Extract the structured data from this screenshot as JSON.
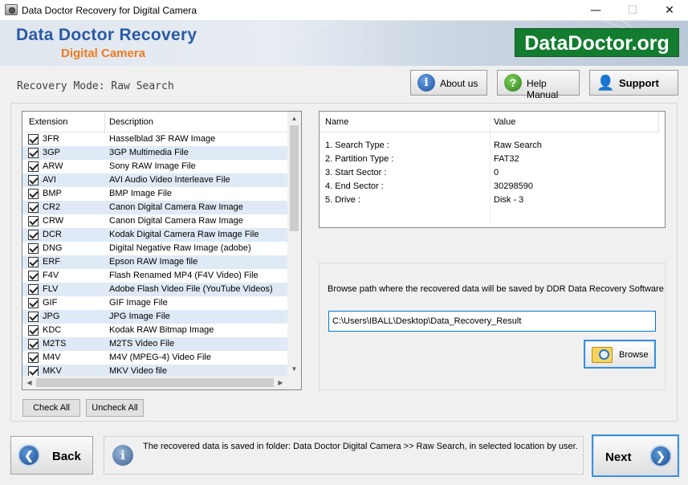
{
  "window": {
    "title": "Data Doctor Recovery for Digital Camera",
    "min": "—",
    "max": "☐",
    "close": "✕"
  },
  "banner": {
    "brand_line1": "Data Doctor Recovery",
    "brand_line2": "Digital Camera",
    "logo": "DataDoctor.org"
  },
  "header": {
    "mode_label": "Recovery Mode: Raw Search",
    "about_label": "About us",
    "help_label": "Help Manual",
    "support_label": "Support"
  },
  "extensions": {
    "col_extension": "Extension",
    "col_description": "Description",
    "items": [
      {
        "ext": "3FR",
        "desc": "Hasselblad 3F RAW Image"
      },
      {
        "ext": "3GP",
        "desc": "3GP Multimedia File"
      },
      {
        "ext": "ARW",
        "desc": "Sony RAW Image File"
      },
      {
        "ext": "AVI",
        "desc": "AVI Audio Video Interleave File"
      },
      {
        "ext": "BMP",
        "desc": "BMP Image File"
      },
      {
        "ext": "CR2",
        "desc": "Canon Digital Camera Raw Image"
      },
      {
        "ext": "CRW",
        "desc": "Canon Digital Camera Raw Image"
      },
      {
        "ext": "DCR",
        "desc": "Kodak Digital Camera Raw Image File"
      },
      {
        "ext": "DNG",
        "desc": "Digital Negative Raw Image (adobe)"
      },
      {
        "ext": "ERF",
        "desc": "Epson RAW Image file"
      },
      {
        "ext": "F4V",
        "desc": "Flash Renamed MP4 (F4V Video) File"
      },
      {
        "ext": "FLV",
        "desc": "Adobe Flash Video File (YouTube Videos)"
      },
      {
        "ext": "GIF",
        "desc": "GIF Image File"
      },
      {
        "ext": "JPG",
        "desc": "JPG Image File"
      },
      {
        "ext": "KDC",
        "desc": "Kodak RAW Bitmap Image"
      },
      {
        "ext": "M2TS",
        "desc": "M2TS Video File"
      },
      {
        "ext": "M4V",
        "desc": "M4V (MPEG-4) Video File"
      },
      {
        "ext": "MKV",
        "desc": "MKV Video file"
      }
    ],
    "check_all": "Check All",
    "uncheck_all": "Uncheck All"
  },
  "properties": {
    "col_name": "Name",
    "col_value": "Value",
    "rows": [
      {
        "name": "1. Search Type :",
        "value": "Raw Search"
      },
      {
        "name": "2. Partition Type :",
        "value": "FAT32"
      },
      {
        "name": "3. Start Sector :",
        "value": "0"
      },
      {
        "name": "4. End Sector :",
        "value": "30298590"
      },
      {
        "name": "5. Drive :",
        "value": "Disk - 3"
      }
    ]
  },
  "browse": {
    "label": "Browse path where the recovered data will be saved by DDR Data Recovery Software",
    "path": "C:\\Users\\IBALL\\Desktop\\Data_Recovery_Result",
    "button": "Browse"
  },
  "footer": {
    "back": "Back",
    "info": "The recovered data is saved in folder: Data Doctor Digital Camera  >> Raw Search, in selected location by user.",
    "next": "Next"
  }
}
